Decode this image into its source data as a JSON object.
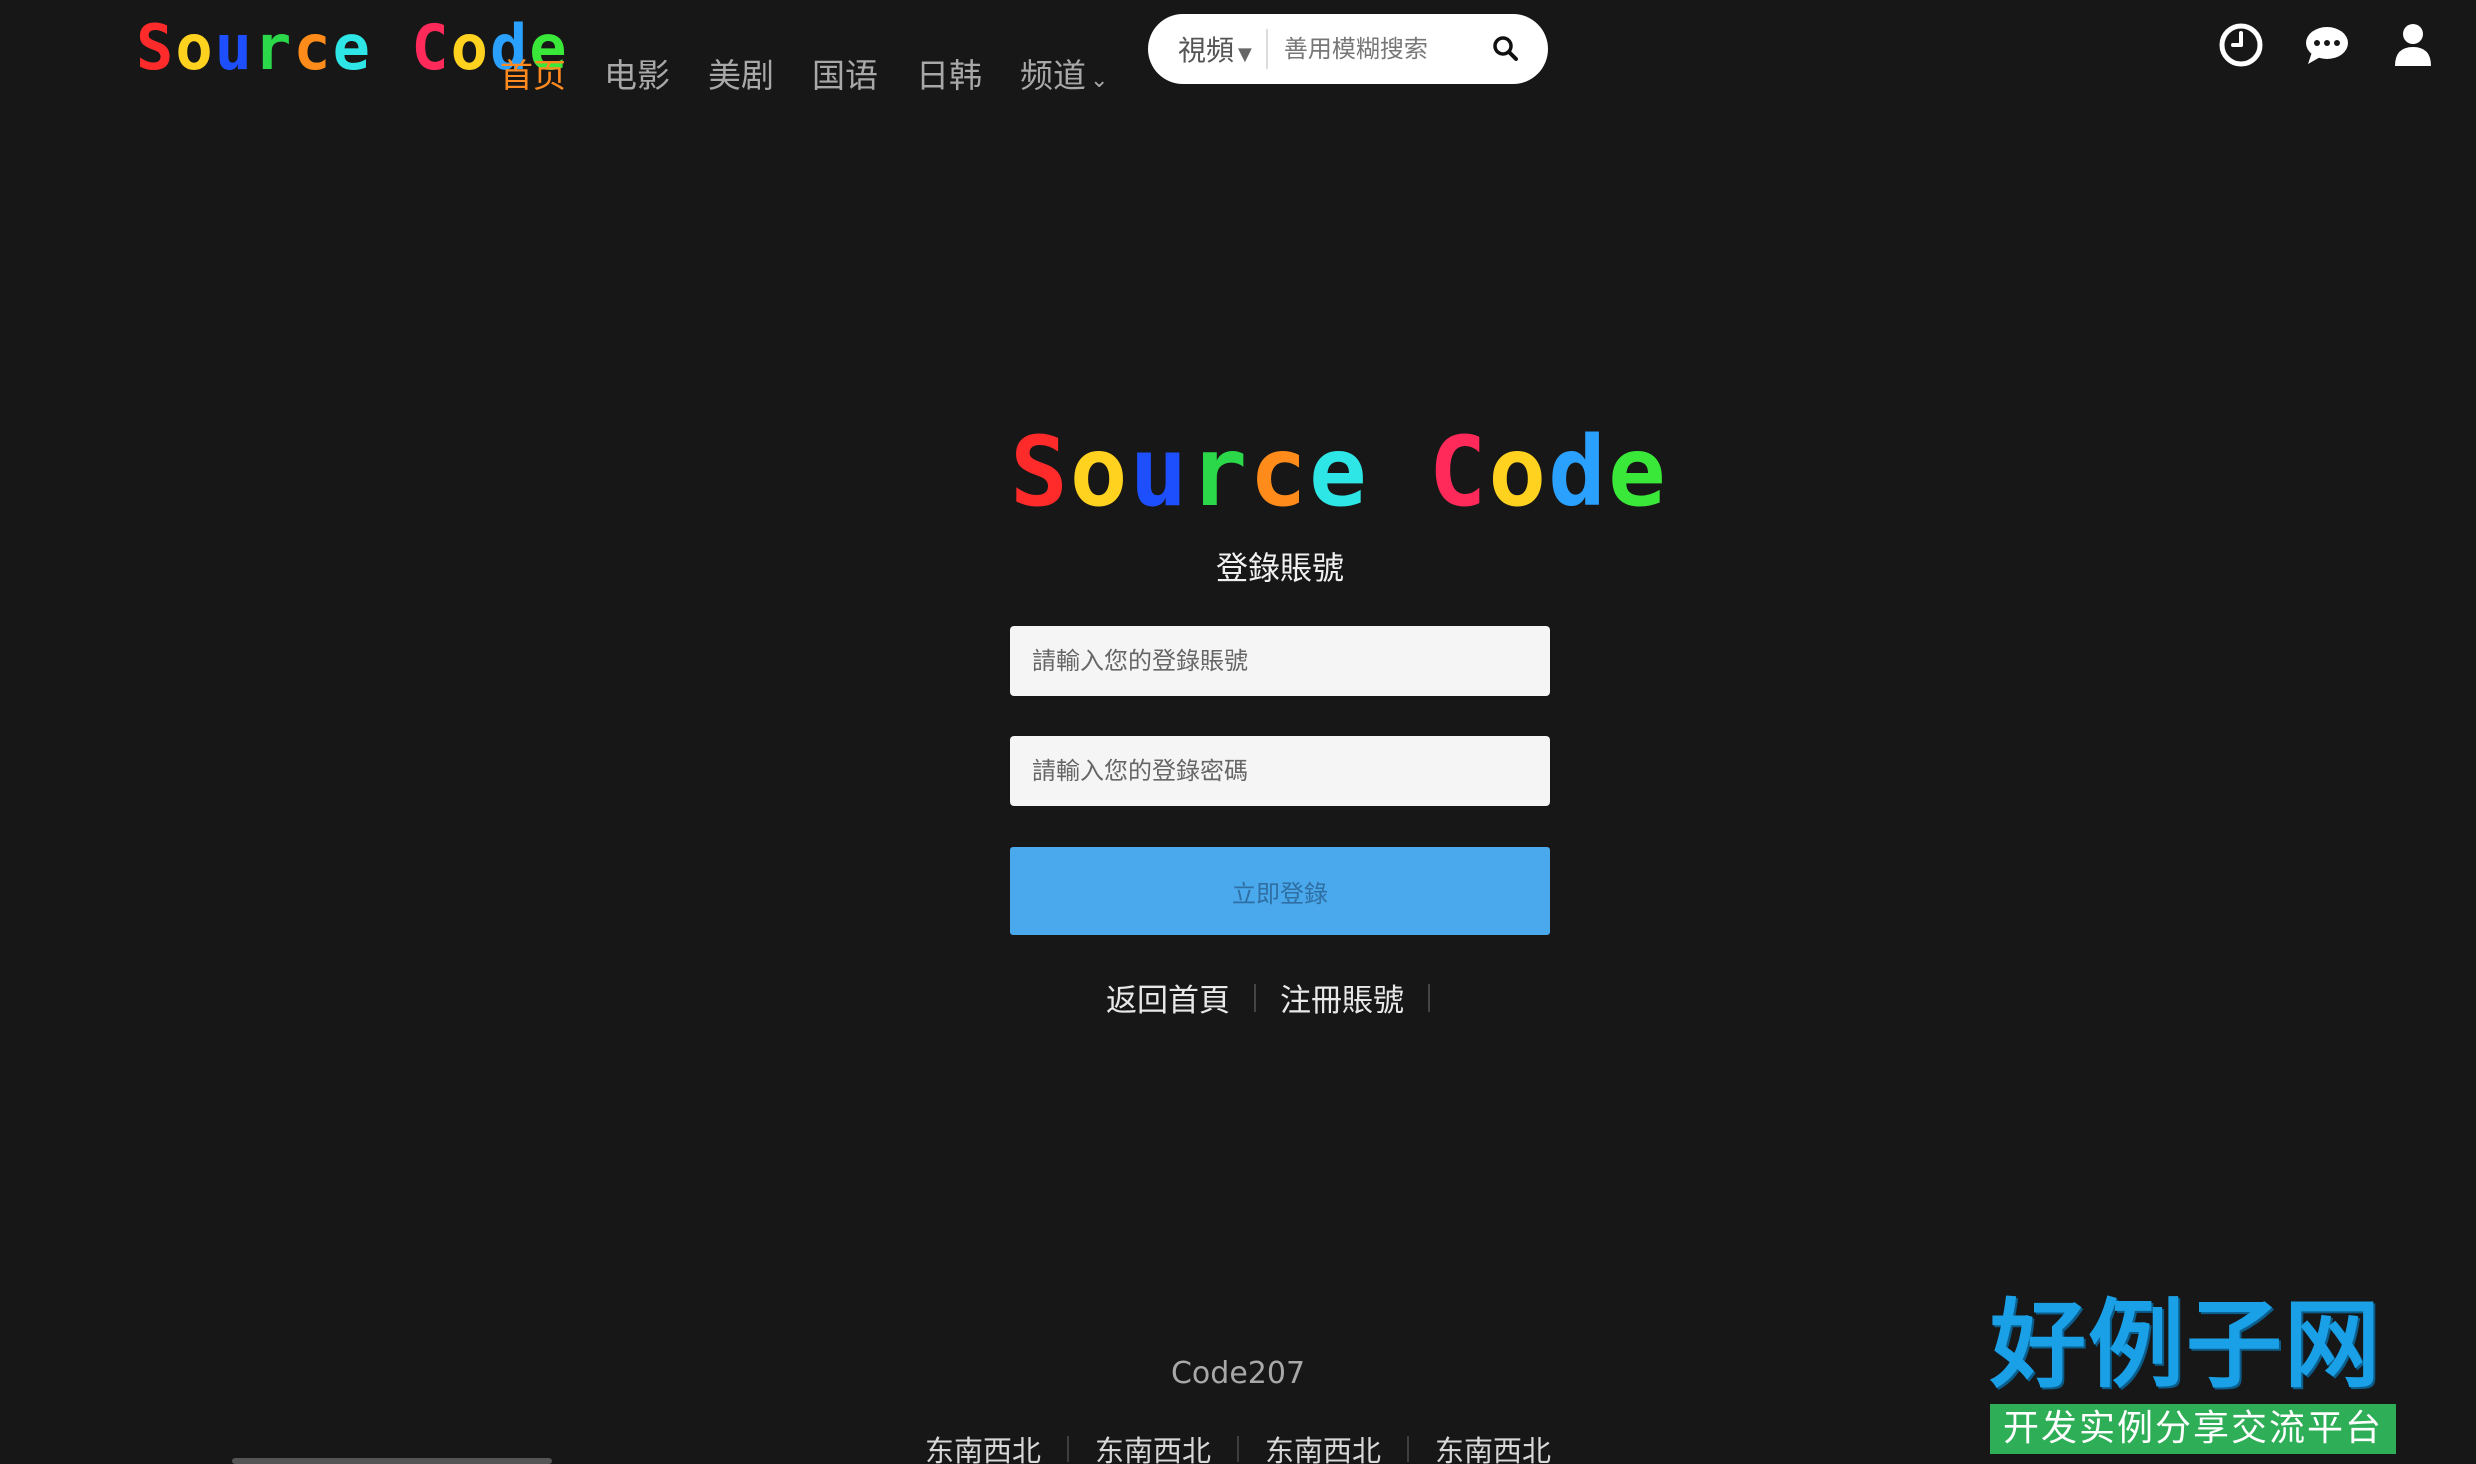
{
  "logo": {
    "letters": [
      {
        "ch": "S",
        "color": "#ff2a2a"
      },
      {
        "ch": "o",
        "color": "#ffd21f"
      },
      {
        "ch": "u",
        "color": "#1e4fff"
      },
      {
        "ch": "r",
        "color": "#2ad84a"
      },
      {
        "ch": "c",
        "color": "#ff8c1a"
      },
      {
        "ch": "e",
        "color": "#2ee6e6"
      },
      {
        "ch": " ",
        "color": "#ffffff"
      },
      {
        "ch": "C",
        "color": "#ff2a5a"
      },
      {
        "ch": "o",
        "color": "#ffd21f"
      },
      {
        "ch": "d",
        "color": "#2aa0ff"
      },
      {
        "ch": "e",
        "color": "#3ae83a"
      }
    ]
  },
  "nav": {
    "items": [
      {
        "label": "首页",
        "active": true
      },
      {
        "label": "电影",
        "active": false
      },
      {
        "label": "美剧",
        "active": false
      },
      {
        "label": "国语",
        "active": false
      },
      {
        "label": "日韩",
        "active": false
      },
      {
        "label": "频道",
        "active": false,
        "dropdown": true
      }
    ]
  },
  "search": {
    "type_label": "視頻",
    "placeholder": "善用模糊搜索"
  },
  "header_icons": [
    "history-clock-icon",
    "comment-icon",
    "user-icon"
  ],
  "login": {
    "title": "登錄賬號",
    "username_placeholder": "請輸入您的登錄賬號",
    "password_placeholder": "請輸入您的登錄密碼",
    "submit_label": "立即登錄",
    "links": [
      "返回首頁",
      "注冊賬號"
    ]
  },
  "footer": {
    "brand": "Code207",
    "links": [
      "东南西北",
      "东南西北",
      "东南西北",
      "东南西北"
    ]
  },
  "badge": {
    "title": "好例子网",
    "subtitle": "开发实例分享交流平台"
  },
  "colors": {
    "background": "#171717",
    "nav_active": "#ff8a1f",
    "nav_inactive": "#a8a8a8",
    "submit_bg": "#4aa8ec",
    "badge_blue": "#1aa0e6",
    "badge_green": "#2eae56"
  }
}
